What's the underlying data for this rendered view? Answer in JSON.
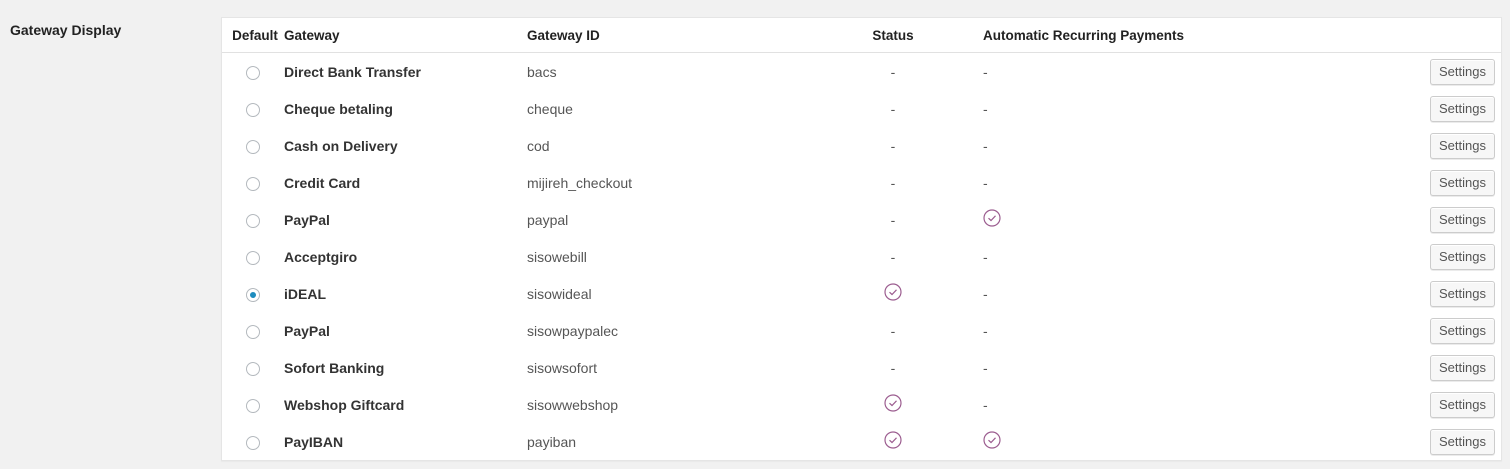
{
  "section_label": "Gateway Display",
  "headers": {
    "default": "Default",
    "gateway": "Gateway",
    "gateway_id": "Gateway ID",
    "status": "Status",
    "recurring": "Automatic Recurring Payments"
  },
  "settings_label": "Settings",
  "dash": "-",
  "accent_colors": {
    "check": "#9b5c8f",
    "radio_selected": "#1e8cbe"
  },
  "rows": [
    {
      "name": "Direct Bank Transfer",
      "id": "bacs",
      "default": false,
      "status": false,
      "recurring": false
    },
    {
      "name": "Cheque betaling",
      "id": "cheque",
      "default": false,
      "status": false,
      "recurring": false
    },
    {
      "name": "Cash on Delivery",
      "id": "cod",
      "default": false,
      "status": false,
      "recurring": false
    },
    {
      "name": "Credit Card",
      "id": "mijireh_checkout",
      "default": false,
      "status": false,
      "recurring": false
    },
    {
      "name": "PayPal",
      "id": "paypal",
      "default": false,
      "status": false,
      "recurring": true
    },
    {
      "name": "Acceptgiro",
      "id": "sisowebill",
      "default": false,
      "status": false,
      "recurring": false
    },
    {
      "name": "iDEAL",
      "id": "sisowideal",
      "default": true,
      "status": true,
      "recurring": false
    },
    {
      "name": "PayPal",
      "id": "sisowpaypalec",
      "default": false,
      "status": false,
      "recurring": false
    },
    {
      "name": "Sofort Banking",
      "id": "sisowsofort",
      "default": false,
      "status": false,
      "recurring": false
    },
    {
      "name": "Webshop Giftcard",
      "id": "sisowwebshop",
      "default": false,
      "status": true,
      "recurring": false
    },
    {
      "name": "PayIBAN",
      "id": "payiban",
      "default": false,
      "status": true,
      "recurring": true
    }
  ]
}
